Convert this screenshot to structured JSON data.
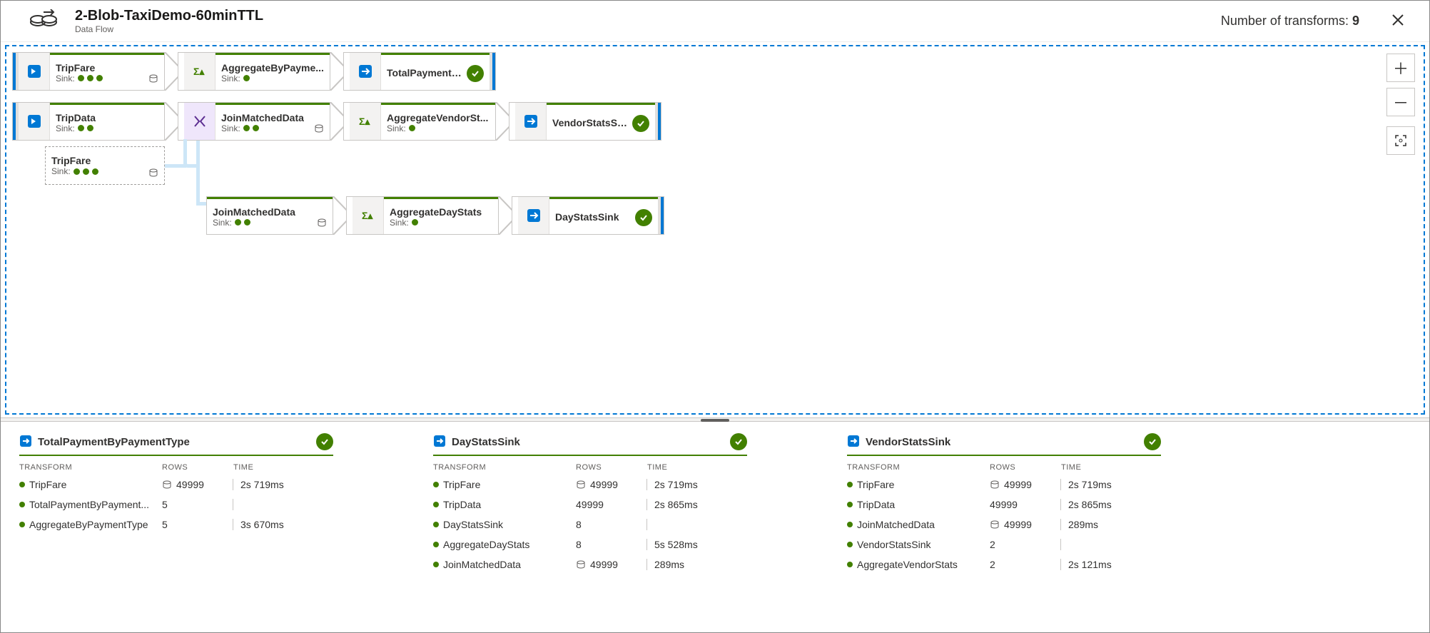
{
  "header": {
    "title": "2-Blob-TaxiDemo-60minTTL",
    "subtitle": "Data Flow",
    "countLabel": "Number of transforms:",
    "countValue": "9"
  },
  "nodes": {
    "n1": {
      "title": "TripFare",
      "sinkLabel": "Sink:",
      "dots": 3
    },
    "n2": {
      "title": "AggregateByPayme...",
      "sinkLabel": "Sink:",
      "dots": 1
    },
    "n3": {
      "title": "TotalPaymentBy..."
    },
    "n4": {
      "title": "TripData",
      "sinkLabel": "Sink:",
      "dots": 2
    },
    "n5": {
      "title": "JoinMatchedData",
      "sinkLabel": "Sink:",
      "dots": 2
    },
    "n6": {
      "title": "AggregateVendorSt...",
      "sinkLabel": "Sink:",
      "dots": 1
    },
    "n7": {
      "title": "VendorStatsSink"
    },
    "n8": {
      "title": "TripFare",
      "sinkLabel": "Sink:",
      "dots": 3
    },
    "n9": {
      "title": "JoinMatchedData",
      "sinkLabel": "Sink:",
      "dots": 2
    },
    "n10": {
      "title": "AggregateDayStats",
      "sinkLabel": "Sink:",
      "dots": 1
    },
    "n11": {
      "title": "DayStatsSink"
    }
  },
  "panels": [
    {
      "title": "TotalPaymentByPaymentType",
      "headers": {
        "c1": "TRANSFORM",
        "c2": "ROWS",
        "c3": "TIME"
      },
      "rows": [
        {
          "name": "TripFare",
          "rows": "49999",
          "time": "2s 719ms",
          "db": true
        },
        {
          "name": "TotalPaymentByPayment...",
          "rows": "5",
          "time": "",
          "db": false
        },
        {
          "name": "AggregateByPaymentType",
          "rows": "5",
          "time": "3s 670ms",
          "db": false
        }
      ]
    },
    {
      "title": "DayStatsSink",
      "headers": {
        "c1": "TRANSFORM",
        "c2": "ROWS",
        "c3": "TIME"
      },
      "rows": [
        {
          "name": "TripFare",
          "rows": "49999",
          "time": "2s 719ms",
          "db": true
        },
        {
          "name": "TripData",
          "rows": "49999",
          "time": "2s 865ms",
          "db": false
        },
        {
          "name": "DayStatsSink",
          "rows": "8",
          "time": "",
          "db": false
        },
        {
          "name": "AggregateDayStats",
          "rows": "8",
          "time": "5s 528ms",
          "db": false
        },
        {
          "name": "JoinMatchedData",
          "rows": "49999",
          "time": "289ms",
          "db": true
        }
      ]
    },
    {
      "title": "VendorStatsSink",
      "headers": {
        "c1": "TRANSFORM",
        "c2": "ROWS",
        "c3": "TIME"
      },
      "rows": [
        {
          "name": "TripFare",
          "rows": "49999",
          "time": "2s 719ms",
          "db": true
        },
        {
          "name": "TripData",
          "rows": "49999",
          "time": "2s 865ms",
          "db": false
        },
        {
          "name": "JoinMatchedData",
          "rows": "49999",
          "time": "289ms",
          "db": true
        },
        {
          "name": "VendorStatsSink",
          "rows": "2",
          "time": "",
          "db": false
        },
        {
          "name": "AggregateVendorStats",
          "rows": "2",
          "time": "2s 121ms",
          "db": false
        }
      ]
    }
  ]
}
